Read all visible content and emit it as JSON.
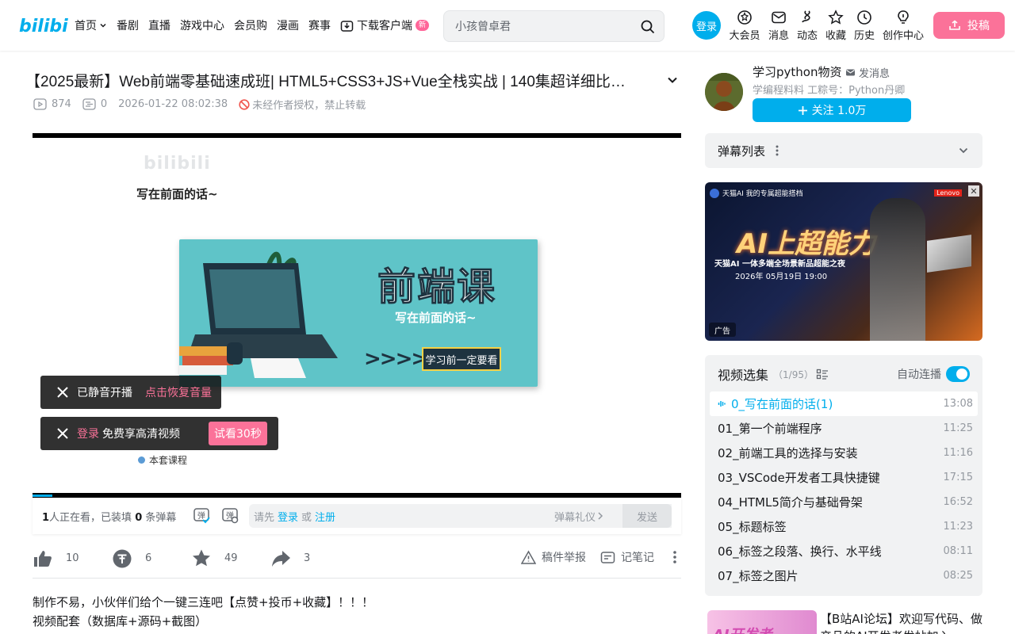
{
  "header": {
    "nav": [
      {
        "label": "首页",
        "has_dropdown": true
      },
      {
        "label": "番剧"
      },
      {
        "label": "直播"
      },
      {
        "label": "游戏中心"
      },
      {
        "label": "会员购"
      },
      {
        "label": "漫画"
      },
      {
        "label": "赛事"
      }
    ],
    "download_label": "下载客户端",
    "new_badge": "新",
    "search_placeholder": "小孩曾卓君",
    "login_label": "登录",
    "entries": [
      {
        "label": "大会员",
        "icon": "vip-icon"
      },
      {
        "label": "消息",
        "icon": "message-icon"
      },
      {
        "label": "动态",
        "icon": "dynamic-icon"
      },
      {
        "label": "收藏",
        "icon": "favorite-icon"
      },
      {
        "label": "历史",
        "icon": "history-icon"
      },
      {
        "label": "创作中心",
        "icon": "creator-icon"
      }
    ],
    "upload_label": "投稿",
    "colors": {
      "brand_blue": "#00aeec",
      "brand_pink": "#fb7299"
    }
  },
  "video": {
    "title": "【2025最新】Web前端零基础速成班| HTML5+CSS3+JS+Vue全栈实战 | 140集超详细比…",
    "views": "874",
    "danmaku_count": "0",
    "pubdate": "2026-01-22 08:02:38",
    "copyright_notice": "未经作者授权，禁止转载"
  },
  "player": {
    "slide_heading": "写在前面的话~",
    "slide_title": "前端课",
    "slide_subtitle": "写在前面的话~",
    "slide_button": "学习前一定要看",
    "slide_footer": "本套课程",
    "progress": 0.03,
    "toast_mute": {
      "text": "已静音开播",
      "action": "点击恢复音量"
    },
    "toast_login": {
      "link": "登录",
      "text": "免费享高清视频",
      "trial": "试看30秒"
    }
  },
  "danmaku_bar": {
    "viewers": "1",
    "viewers_text": "人正在看，已装填",
    "count": "0",
    "count_text": "条弹幕",
    "input_prefix": "请先",
    "login_link": "登录",
    "or_text": "或",
    "register_link": "注册",
    "gift_label": "弹幕礼仪",
    "send_label": "发送"
  },
  "toolbar": {
    "like": "10",
    "coin": "6",
    "favorite": "49",
    "share": "3",
    "report_label": "稿件举报",
    "note_label": "记笔记"
  },
  "description": [
    "制作不易，小伙伴们给个一键三连吧【点赞+投币+收藏】！！！",
    "视频配套（数据库+源码+截图）"
  ],
  "uploader": {
    "name": "学习python物资",
    "message_label": "发消息",
    "desc": "学编程料料 工粽号：Python丹卿",
    "follow_label": "关注 1.0万"
  },
  "danmaku_list_label": "弹幕列表",
  "ad": {
    "brand_line": "天猫AI  我的专属超能搭档",
    "lenovo": "Lenovo",
    "big_text": "AI上超能力",
    "sub_text": "天猫AI 一体多端全场景新品超能之夜",
    "date_text": "2026年 05月19日 19:00",
    "tag": "广告"
  },
  "playlist": {
    "title": "视频选集",
    "count": "（1/95）",
    "autoplay_label": "自动连播",
    "autoplay_on": true,
    "items": [
      {
        "title": "0_写在前面的话(1)",
        "duration": "13:08",
        "active": true
      },
      {
        "title": "01_第一个前端程序",
        "duration": "11:25"
      },
      {
        "title": "02_前端工具的选择与安装",
        "duration": "11:16"
      },
      {
        "title": "03_VSCode开发者工具快捷键",
        "duration": "17:15"
      },
      {
        "title": "04_HTML5简介与基础骨架",
        "duration": "16:52"
      },
      {
        "title": "05_标题标签",
        "duration": "11:23"
      },
      {
        "title": "06_标签之段落、换行、水平线",
        "duration": "08:11"
      },
      {
        "title": "07_标签之图片",
        "duration": "08:25"
      }
    ]
  },
  "recommend": {
    "thumb_text": "AI开发者",
    "title": "【B站AI论坛】欢迎写代码、做产品的AI开发者发帖加入"
  }
}
